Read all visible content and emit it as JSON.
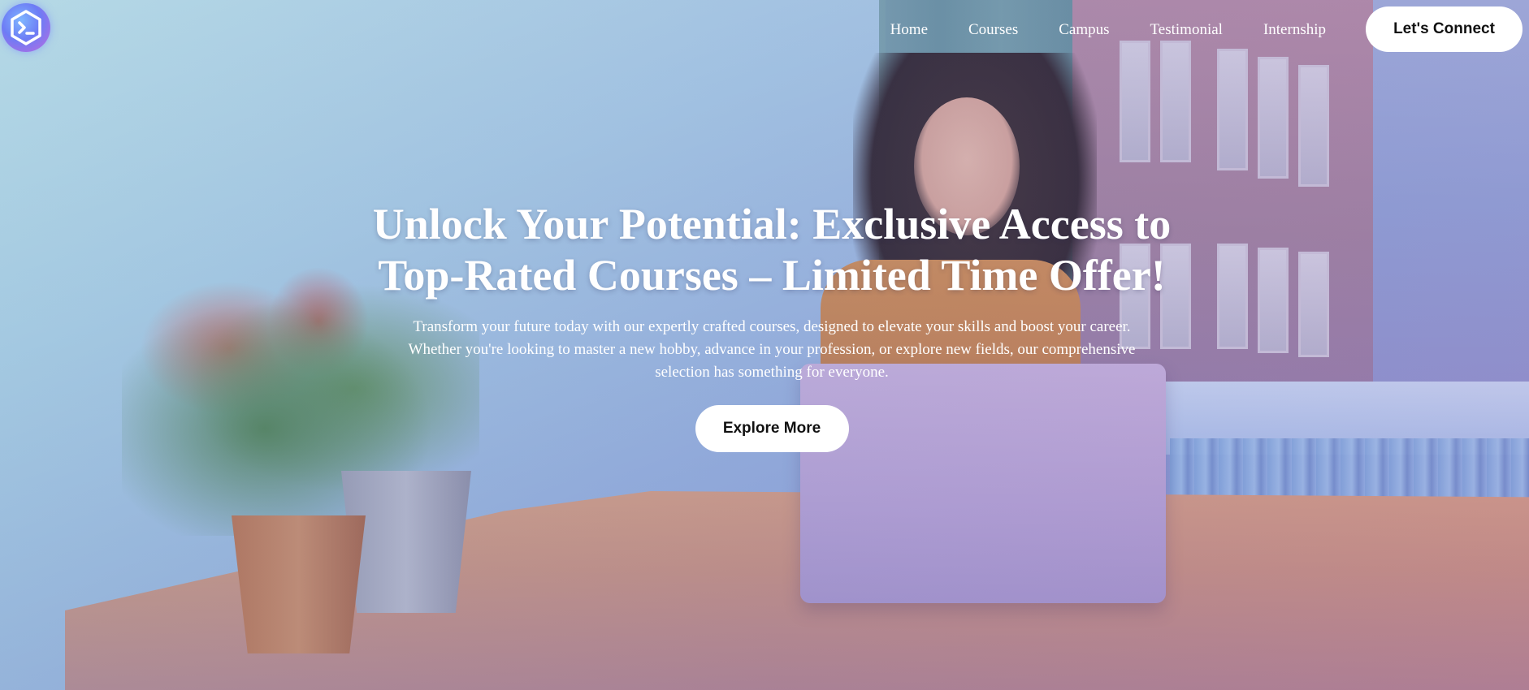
{
  "nav": {
    "logo_icon": "terminal-hexagon-icon",
    "links": [
      "Home",
      "Courses",
      "Campus",
      "Testimonial",
      "Internship"
    ],
    "cta_label": "Let's Connect"
  },
  "hero": {
    "title": "Unlock Your Potential: Exclusive Access to Top-Rated Courses – Limited Time Offer!",
    "subtitle": "Transform your future today with our expertly crafted courses, designed to elevate your skills and boost your career. Whether you're looking to master a new hobby, advance in your profession, or explore new fields, our comprehensive selection has something for everyone.",
    "button_label": "Explore More"
  },
  "colors": {
    "text": "#ffffff",
    "button_bg": "#ffffff",
    "button_text": "#111111",
    "logo_gradient": [
      "#7fb6ff",
      "#6d7cf5",
      "#c06adf"
    ]
  }
}
